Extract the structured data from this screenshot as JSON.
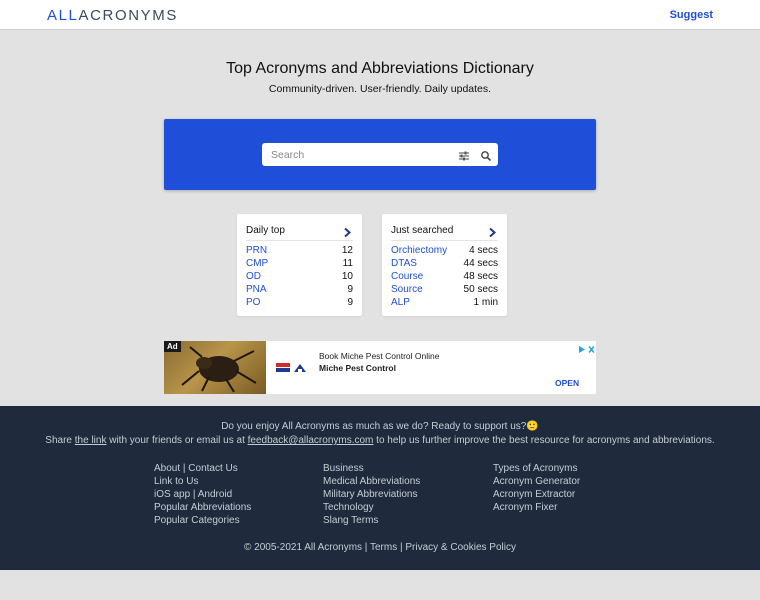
{
  "header": {
    "logo_prefix": "ALL",
    "logo_rest": "ACRONYMS",
    "suggest_label": "Suggest"
  },
  "hero": {
    "title": "Top Acronyms and Abbreviations Dictionary",
    "subtitle": "Community-driven. User-friendly. Daily updates."
  },
  "search": {
    "placeholder": "Search",
    "filter_icon": "sliders-icon",
    "search_icon": "search-icon"
  },
  "daily_top": {
    "heading": "Daily top",
    "rows": [
      {
        "term": "PRN",
        "value": "12"
      },
      {
        "term": "CMP",
        "value": "11"
      },
      {
        "term": "OD",
        "value": "10"
      },
      {
        "term": "PNA",
        "value": "9"
      },
      {
        "term": "PO",
        "value": "9"
      }
    ]
  },
  "just_searched": {
    "heading": "Just searched",
    "rows": [
      {
        "term": "Orchiectomy",
        "value": "4 secs"
      },
      {
        "term": "DTAS",
        "value": "44 secs"
      },
      {
        "term": "Course",
        "value": "48 secs"
      },
      {
        "term": "Source",
        "value": "50 secs"
      },
      {
        "term": "ALP",
        "value": "1 min"
      }
    ]
  },
  "ad": {
    "badge": "Ad",
    "title": "Book Miche Pest Control Online",
    "advertiser": "Miche Pest Control",
    "cta": "OPEN"
  },
  "footer": {
    "line1": "Do you enjoy All Acronyms as much as we do? Ready to support us?🙂",
    "line2_pre": "Share ",
    "line2_link": "the link",
    "line2_mid": " with your friends or email us at ",
    "line2_email": "feedback@allacronyms.com",
    "line2_post": " to help us further improve the best resource for acronyms and abbreviations.",
    "col1": [
      "About | Contact Us",
      "Link to Us",
      "iOS app | Android",
      "Popular Abbreviations",
      "Popular Categories"
    ],
    "col2": [
      "Business",
      "Medical Abbreviations",
      "Military Abbreviations",
      "Technology",
      "Slang Terms"
    ],
    "col3": [
      "Types of Acronyms",
      "Acronym Generator",
      "Acronym Extractor",
      "Acronym Fixer"
    ],
    "copyright": "© 2005-2021 All Acronyms | Terms | Privacy & Cookies Policy"
  }
}
